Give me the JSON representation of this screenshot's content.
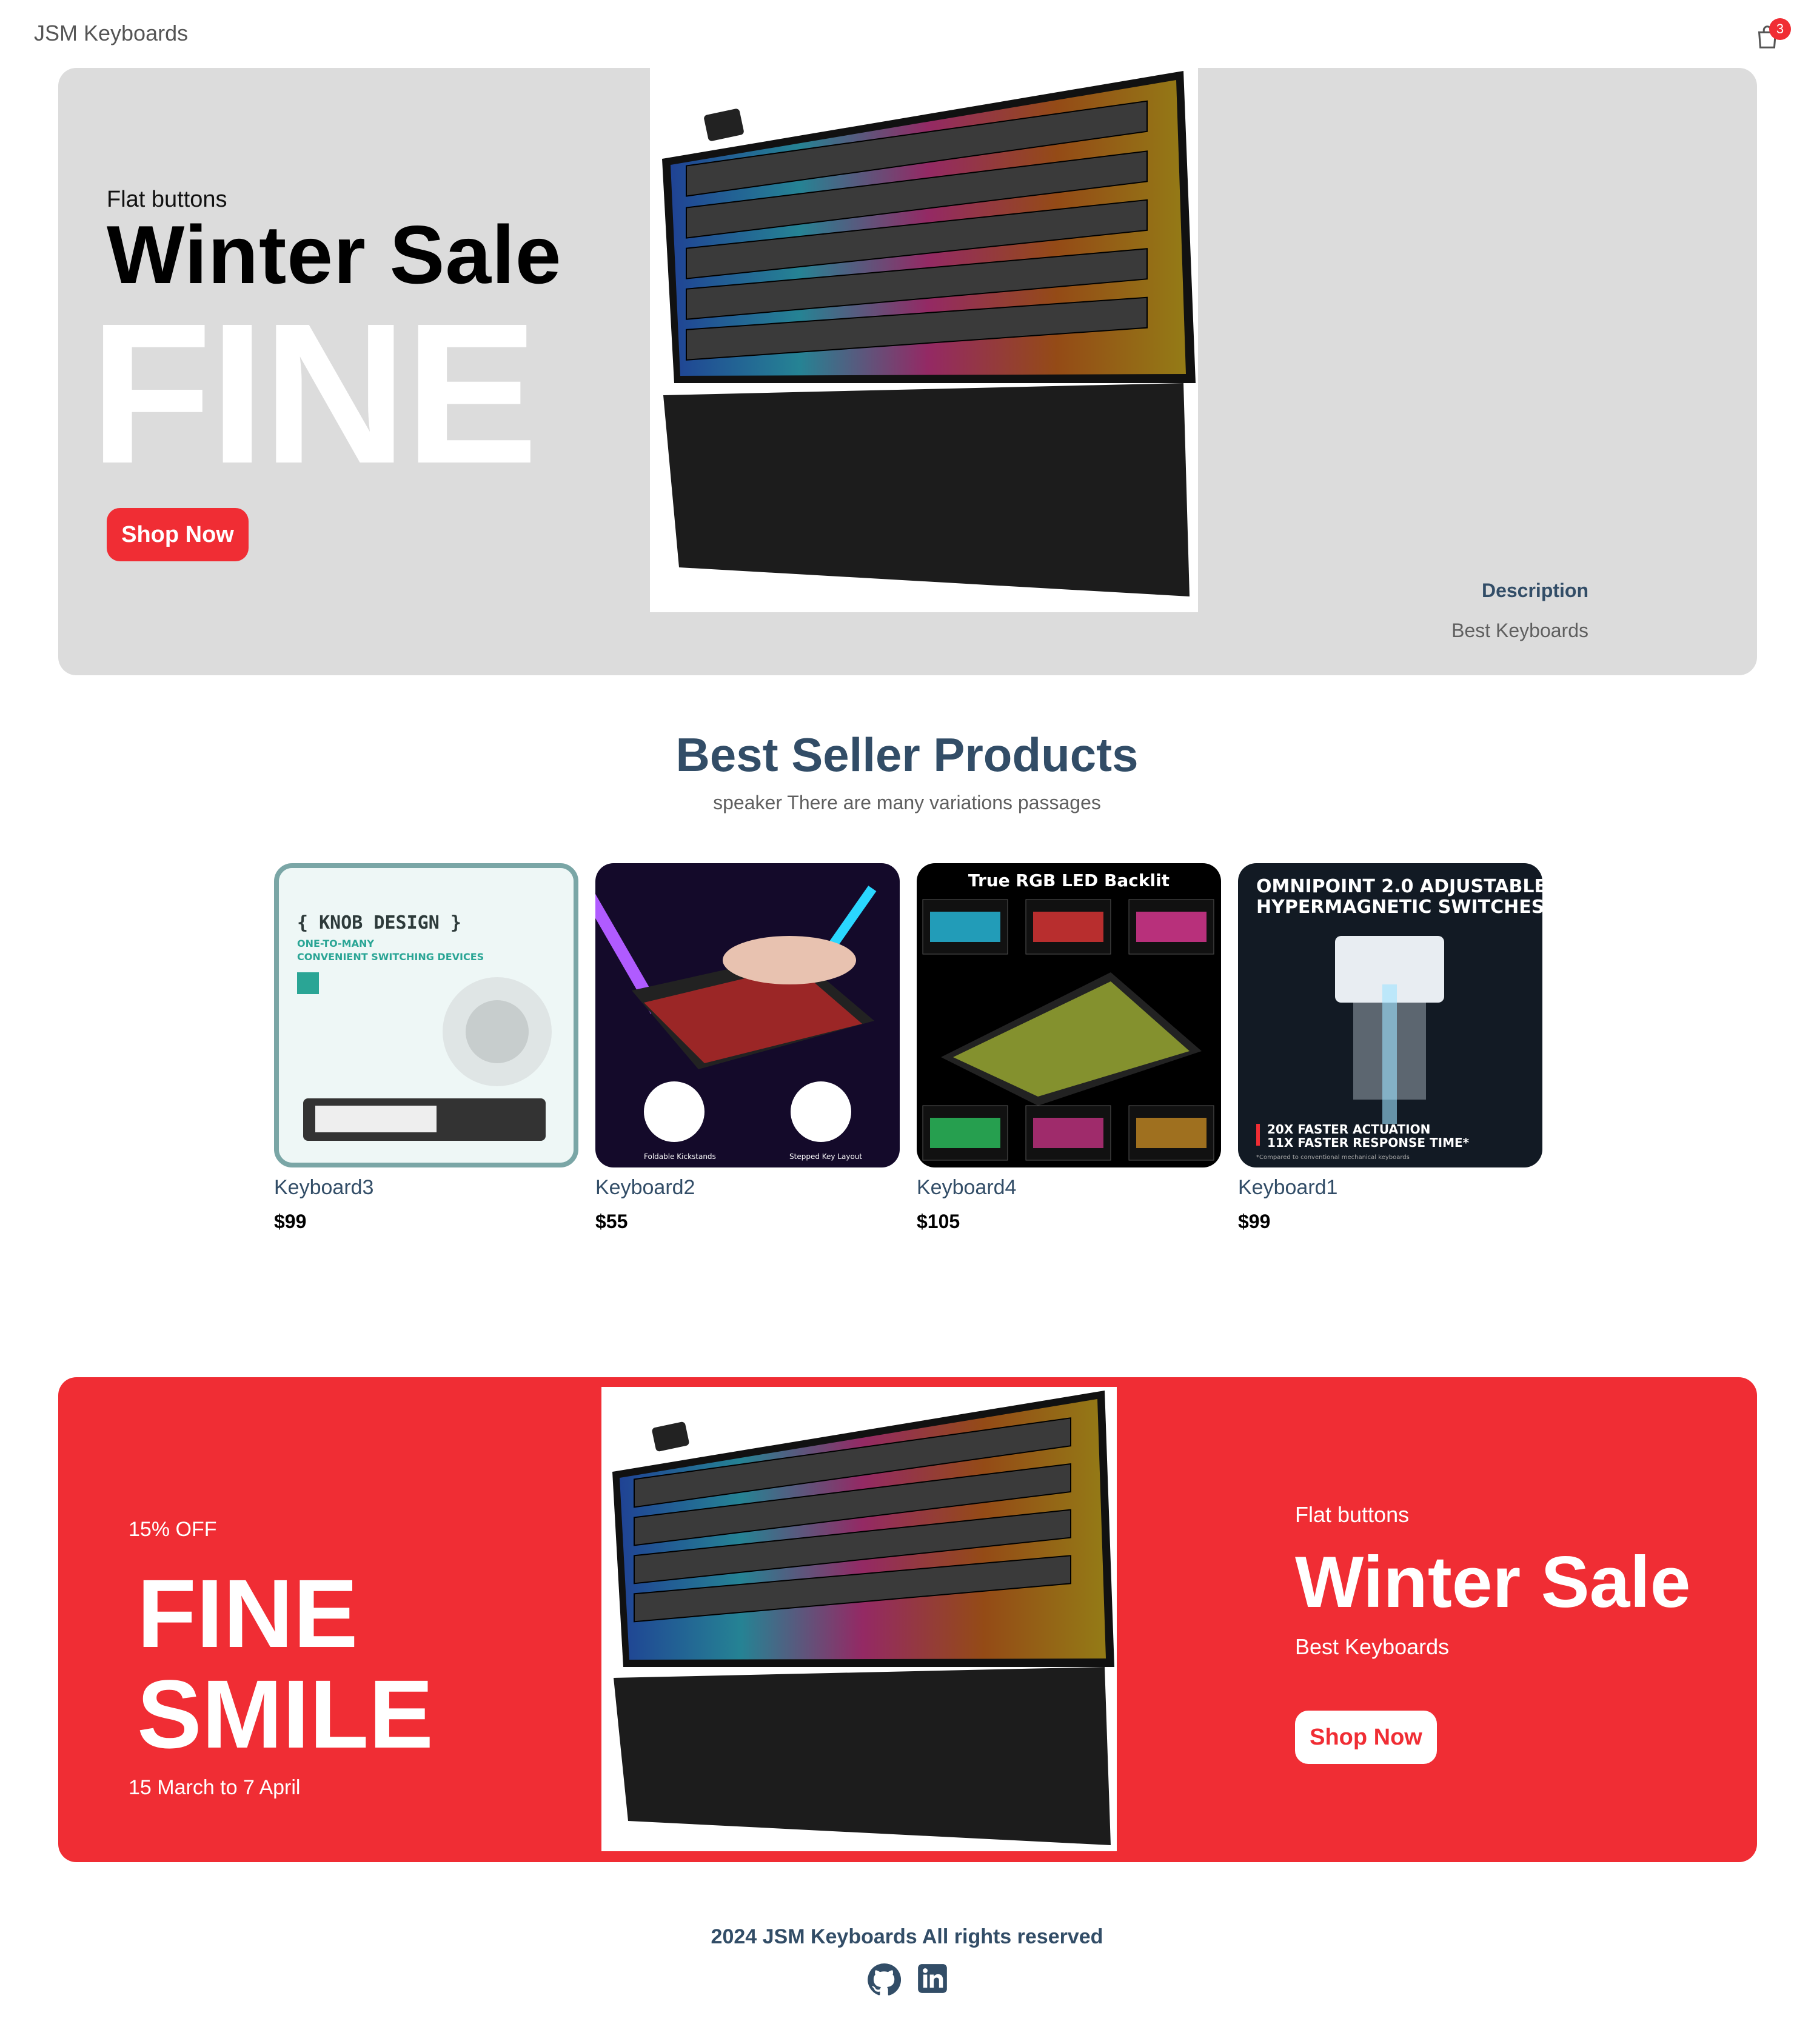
{
  "navbar": {
    "brand": "JSM Keyboards",
    "cart_icon": "cart-icon",
    "cart_count": "3"
  },
  "hero": {
    "small_text": "Flat buttons",
    "mid_text": "Winter Sale",
    "large_text": "FINE",
    "button_label": "Shop Now",
    "image": "keyboard-rgb-with-wrist-rest",
    "desc_title": "Description",
    "desc_text": "Best Keyboards"
  },
  "best_sellers": {
    "title": "Best Seller Products",
    "subtitle": "speaker There are many variations passages",
    "products": [
      {
        "name": "Keyboard3",
        "price": "$99",
        "image": "knob-design-keyboard",
        "image_text": [
          "{ KNOB DESIGN }",
          "ONE-TO-MANY",
          "CONVENIENT SWITCHING DEVICES"
        ]
      },
      {
        "name": "Keyboard2",
        "price": "$55",
        "image": "compact-rgb-keyboard-hand",
        "image_text": [
          "Foldable Kickstands",
          "Stepped Key Layout"
        ]
      },
      {
        "name": "Keyboard4",
        "price": "$105",
        "image": "true-rgb-led-backlit-keyboard",
        "image_text": [
          "True RGB LED Backlit"
        ]
      },
      {
        "name": "Keyboard1",
        "price": "$99",
        "image": "omnipoint-switch",
        "image_text": [
          "OMNIPOINT 2.0 ADJUSTABLE",
          "HYPERMAGNETIC SWITCHES",
          "20X FASTER ACTUATION",
          "11X FASTER RESPONSE TIME*",
          "*Compared to conventional mechanical keyboards"
        ]
      }
    ]
  },
  "footer_banner": {
    "discount": "15% OFF",
    "large_text1": "FINE",
    "large_text2": "SMILE",
    "sale_time": "15 March to 7 April",
    "small_text": "Flat buttons",
    "mid_text": "Winter Sale",
    "desc": "Best Keyboards",
    "button_label": "Shop Now",
    "image": "keyboard-rgb-with-wrist-rest"
  },
  "footer": {
    "copyright": "2024 JSM Keyboards All rights reserved",
    "icons": [
      "github-icon",
      "linkedin-icon"
    ]
  },
  "colors": {
    "accent": "#f02d34",
    "heading": "#324d67",
    "hero_bg": "#dcdcdc"
  }
}
